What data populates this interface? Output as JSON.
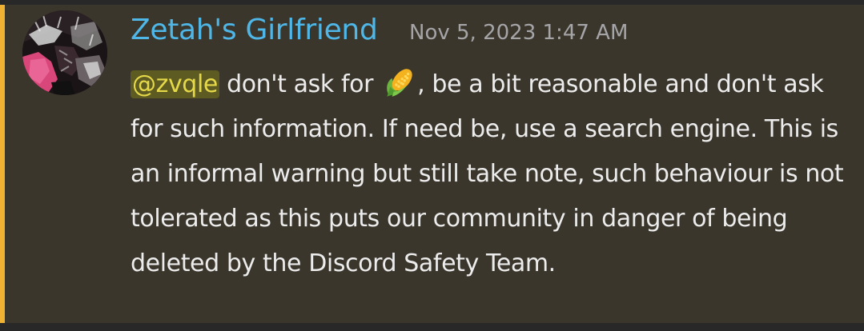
{
  "message": {
    "username": "Zetah's Girlfriend",
    "timestamp": "Nov 5, 2023 1:47 AM",
    "mention": "@zvqle",
    "emoji": "corn-emoji",
    "text_part1": " don't ask for ",
    "text_part2": ", be a bit reasonable and don't ask for such information. If need be, use a search engine. This is an informal warning but still take note, such behaviour is not tolerated as this puts our community in danger of being deleted by the Discord Safety Team."
  },
  "colors": {
    "username": "#4fb7e8",
    "highlight_bar": "#f0b232",
    "message_bg": "#3b362c",
    "mention_bg": "#5d5a22",
    "mention_text": "#e5d94a",
    "text": "#ececec",
    "timestamp": "#a5a5a8"
  }
}
